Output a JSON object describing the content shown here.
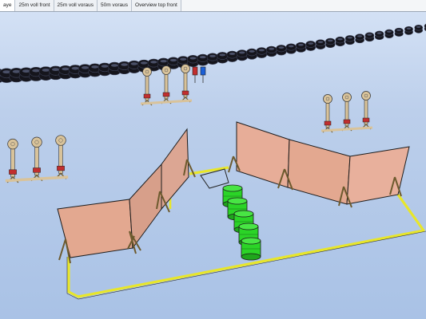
{
  "tabs": [
    {
      "label": "aye"
    },
    {
      "label": "25m voll front"
    },
    {
      "label": "25m voll voraus"
    },
    {
      "label": "50m voraus"
    },
    {
      "label": "Overview top front"
    }
  ],
  "active_tab_index": 0,
  "scene": {
    "background_color": "#bccfeb",
    "tire_wall_color": "#15151c",
    "panel_color": "#e3a890",
    "barrel_color": "#2bd427",
    "boundary_color": "#e8e62a",
    "steel_target_color": "#d9c39a",
    "target_head_color": "#c22e2e"
  }
}
